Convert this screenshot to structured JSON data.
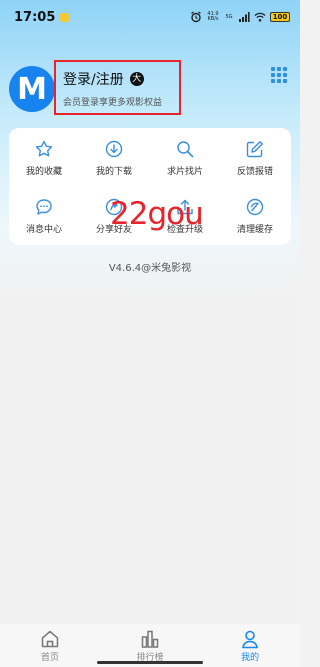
{
  "status_bar": {
    "time": "17:05",
    "net_speed": "41.9 KB/s",
    "net_type": "5G",
    "battery": "100"
  },
  "profile": {
    "avatar_letter": "M",
    "title": "登录/注册",
    "vip_icon_text": "大",
    "subtitle": "会员登录享更多观影权益"
  },
  "menu": {
    "items": [
      {
        "label": "我的收藏",
        "icon": "star-icon"
      },
      {
        "label": "我的下载",
        "icon": "download-icon"
      },
      {
        "label": "求片找片",
        "icon": "search-icon"
      },
      {
        "label": "反馈报错",
        "icon": "edit-icon"
      },
      {
        "label": "消息中心",
        "icon": "message-icon"
      },
      {
        "label": "分享好友",
        "icon": "share-icon"
      },
      {
        "label": "检查升级",
        "icon": "upgrade-icon"
      },
      {
        "label": "清理缓存",
        "icon": "clean-icon"
      }
    ]
  },
  "version": "V4.6.4@米兔影视",
  "watermark": "22gou",
  "bottom_nav": {
    "items": [
      {
        "label": "首页",
        "icon": "home-icon",
        "active": false
      },
      {
        "label": "排行榜",
        "icon": "ranking-icon",
        "active": false
      },
      {
        "label": "我的",
        "icon": "profile-icon",
        "active": true
      }
    ]
  },
  "colors": {
    "accent": "#1688f0",
    "highlight_box": "#e8242b",
    "avatar_bg": "#1683ee"
  }
}
